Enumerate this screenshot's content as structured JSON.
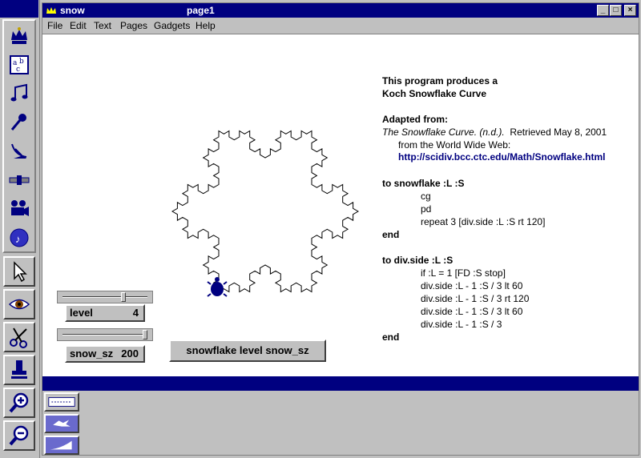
{
  "window": {
    "app_title": "snow",
    "page_title": "page1"
  },
  "menu": {
    "items": [
      "File",
      "Edit",
      "Text",
      "Pages",
      "Gadgets",
      "Help"
    ]
  },
  "palette": {
    "tools": [
      "crown-icon",
      "text-tool-icon",
      "music-note-icon",
      "microphone-icon",
      "satellite-dish-icon",
      "slider-tool-icon",
      "movie-camera-icon",
      "music-disc-icon",
      "arrow-pointer-icon",
      "eye-icon",
      "scissors-icon",
      "stamp-icon",
      "zoom-in-icon",
      "zoom-out-icon"
    ]
  },
  "info": {
    "line1": "This program produces a",
    "line2": "Koch Snowflake Curve",
    "adapted_heading": "Adapted from:",
    "citation_title": "The Snowflake Curve. (n.d.).",
    "citation_rest": "Retrieved May 8, 2001",
    "citation_from": "from the World Wide Web:",
    "citation_url": "http://scidiv.bcc.ctc.edu/Math/Snowflake.html"
  },
  "code": {
    "proc1_header": "to snowflake :L :S",
    "proc1_lines": [
      "cg",
      "pd",
      "repeat 3 [div.side :L :S rt 120]"
    ],
    "proc1_end": "end",
    "proc2_header": "to div.side :L :S",
    "proc2_lines": [
      "if :L = 1 [FD :S stop]",
      "div.side :L - 1 :S / 3 lt 60",
      "div.side :L - 1 :S / 3 rt 120",
      "div.side :L - 1 :S / 3 lt 60",
      "div.side :L - 1 :S / 3"
    ],
    "proc2_end": "end"
  },
  "sliders": {
    "level": {
      "label": "level",
      "value": "4",
      "fraction": 0.74
    },
    "snow_sz": {
      "label": "snow_sz",
      "value": "200",
      "fraction": 1.0
    }
  },
  "button": {
    "label": "snowflake level snow_sz"
  },
  "colors": {
    "titlebar": "#000080",
    "link": "#000080",
    "face": "#c0c0c0"
  }
}
